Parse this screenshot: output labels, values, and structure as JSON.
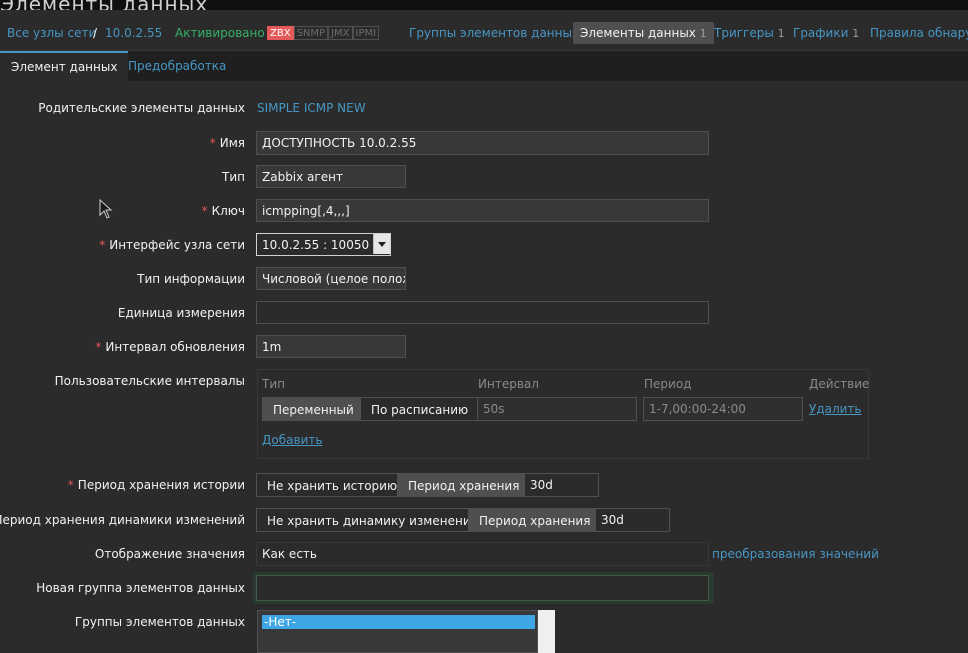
{
  "window": {
    "title": "Элементы данных"
  },
  "header": {
    "all_hosts": "Все узлы сети",
    "slash": "/",
    "host": "10.0.2.55",
    "status": "Активировано",
    "badges": [
      "ZBX",
      "SNMP",
      "JMX",
      "IPMI"
    ],
    "nav": {
      "groups": "Группы элементов данных",
      "items": "Элементы данных",
      "items_count": "1",
      "triggers": "Триггеры",
      "triggers_count": "1",
      "graphs": "Графики",
      "graphs_count": "1",
      "discovery": "Правила обнаруж"
    }
  },
  "tabs": {
    "item": "Элемент данных",
    "preprocessing": "Предобработка"
  },
  "form": {
    "parent_label": "Родительские элементы данных",
    "parent_value": "SIMPLE ICMP NEW",
    "name_label": "Имя",
    "name_value": "ДОСТУПНОСТЬ 10.0.2.55",
    "type_label": "Тип",
    "type_value": "Zabbix агент",
    "key_label": "Ключ",
    "key_value": "icmpping[,4,,,]",
    "iface_label": "Интерфейс узла сети",
    "iface_value": "10.0.2.55 : 10050",
    "info_label": "Тип информации",
    "info_value": "Числовой (целое положи",
    "units_label": "Единица измерения",
    "units_value": "",
    "interval_label": "Интервал обновления",
    "interval_value": "1m",
    "custom_label": "Пользовательские интервалы",
    "custom": {
      "col_type": "Тип",
      "col_interval": "Интервал",
      "col_period": "Период",
      "col_action": "Действие",
      "btn_flexible": "Переменный",
      "btn_scheduling": "По расписанию",
      "interval_value": "50s",
      "period_value": "1-7,00:00-24:00",
      "remove": "Удалить",
      "add": "Добавить"
    },
    "history_label": "Период хранения истории",
    "history_no": "Не хранить историю",
    "history_period": "Период хранения",
    "history_value": "30d",
    "trends_label": "Период хранения динамики изменений",
    "trends_no": "Не хранить динамику изменений",
    "trends_period": "Период хранения",
    "trends_value": "30d",
    "valuemap_label": "Отображение значения",
    "valuemap_value": "Как есть",
    "valuemap_link": "преобразования значений",
    "newgroup_label": "Новая группа элементов данных",
    "newgroup_value": "",
    "groups_label": "Группы элементов данных",
    "groups_selected": "-Нет-"
  }
}
